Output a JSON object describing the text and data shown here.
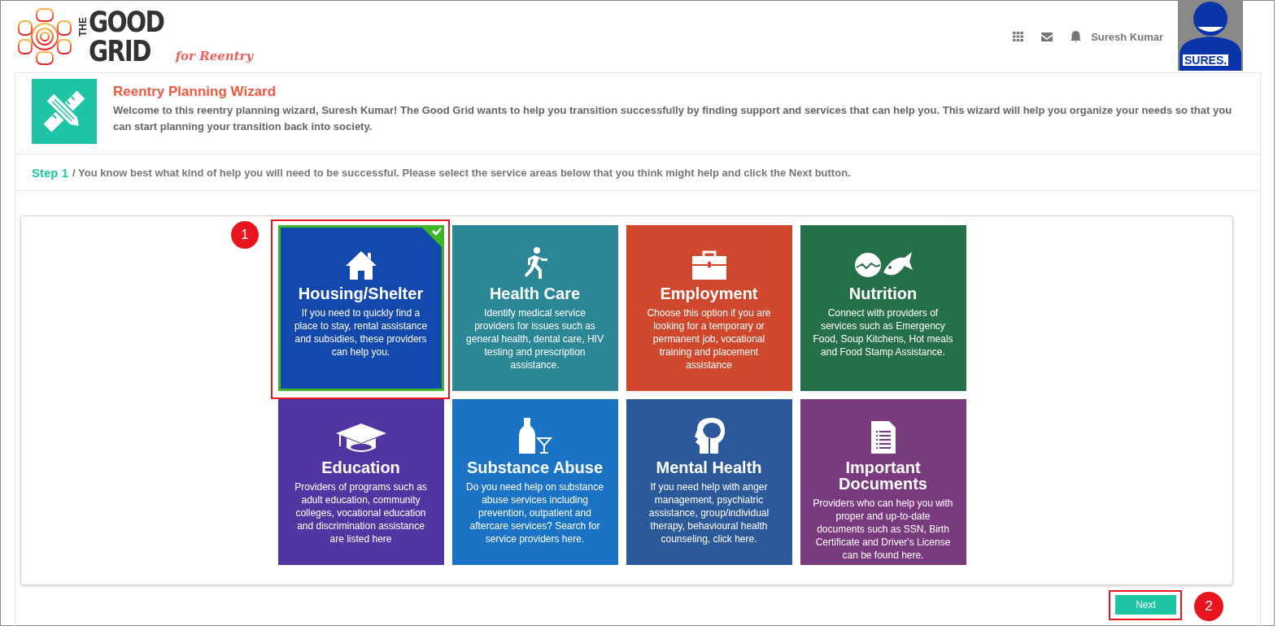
{
  "header": {
    "logo": {
      "small_word": "THE",
      "word_1": "GOOD",
      "word_2": "GRID",
      "tagline": "for Reentry"
    },
    "user_name": "Suresh Kumar",
    "avatar_label": "SURES."
  },
  "intro": {
    "title": "Reentry Planning Wizard",
    "text": "Welcome to this reentry planning wizard, Suresh Kumar! The Good Grid wants to help you transition successfully by finding support and services that can help you. This wizard will help you organize your needs so that you can start planning your transition back into society."
  },
  "step": {
    "label": "Step 1",
    "text": "/ You know best what kind of help you will need to be successful. Please select the service areas below that you think might help and click the Next button."
  },
  "tiles": [
    {
      "title": "Housing/Shelter",
      "description": "If you need to quickly find a place to stay, rental assistance and subsidies, these providers can help you.",
      "selected": true,
      "color": "#1349ad"
    },
    {
      "title": "Health Care",
      "description": "Identify medical service providers for issues such as general health, dental care, HIV testing and prescription assistance.",
      "selected": false,
      "color": "#2b8796"
    },
    {
      "title": "Employment",
      "description": "Choose this option if you are looking for a temporary or permanent job, vocational training and placement assistance",
      "selected": false,
      "color": "#cf472c"
    },
    {
      "title": "Nutrition",
      "description": "Connect with providers of services such as Emergency Food, Soup Kitchens, Hot meals and Food Stamp Assistance.",
      "selected": false,
      "color": "#267049"
    },
    {
      "title": "Education",
      "description": "Providers of programs such as adult education, community colleges, vocational education and discrimination assistance are listed here",
      "selected": false,
      "color": "#5136a3"
    },
    {
      "title": "Substance Abuse",
      "description": "Do you need help on substance abuse services including prevention, outpatient and aftercare services? Search for service providers here.",
      "selected": false,
      "color": "#1a73c4"
    },
    {
      "title": "Mental Health",
      "description": "If you need help with anger management, psychiatric assistance, group/individual therapy, behavioural health counseling, click here.",
      "selected": false,
      "color": "#2c5999"
    },
    {
      "title": "Important Documents",
      "description": "Providers who can help you with proper and up-to-date documents such as SSN, Birth Certificate and Driver's License can be found here.",
      "selected": false,
      "color": "#7a3a7e"
    }
  ],
  "next_button": "Next",
  "annotations": [
    {
      "kind": "tile",
      "number": "1"
    },
    {
      "kind": "button",
      "number": "2"
    }
  ]
}
